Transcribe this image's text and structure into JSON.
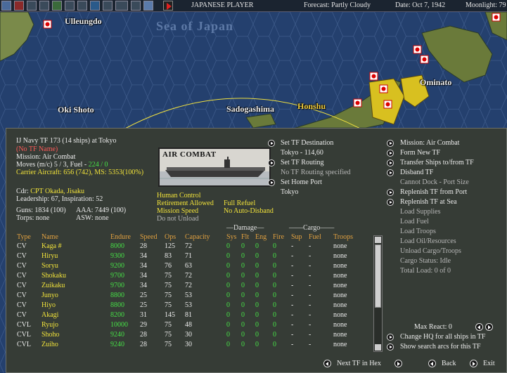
{
  "topbar": {
    "player": "JAPANESE PLAYER",
    "forecast": "Forecast: Partly Cloudy",
    "date": "Date: Oct 7, 1942",
    "moonlight": "Moonlight: 79"
  },
  "map": {
    "sea_label": "Sea of Japan",
    "places": [
      "Ulleungdo",
      "Oki Shoto",
      "Sadogashima",
      "Honshu",
      "Ominato"
    ]
  },
  "tf": {
    "header": "IJ Navy TF 173 (14 ships) at Tokyo",
    "name": "(No TF Name)",
    "mission": "Mission: Air Combat",
    "moves_prefix": "Moves (m/c)  5 / 3, Fuel - ",
    "moves_fuel": "224 / 0",
    "carrier_aircraft": "Carrier Aircraft: 656 (742), MS: 5353(100%)",
    "cdr_label": "Cdr: ",
    "cdr_name": "CPT Okada, Jisaku",
    "leadership": "Leadership: 67, Inspiration: 52",
    "guns": "Guns: 1834 (100)",
    "aaa": "AAA: 7449 (100)",
    "torps": "Torps: none",
    "asw": "ASW: none"
  },
  "photo": {
    "title": "AIR COMBAT"
  },
  "orders": {
    "human_control": "Human Control",
    "retirement": "Retirement Allowed",
    "mission_speed": "Mission Speed",
    "do_not_unload": "Do not Unload",
    "full_refuel": "Full Refuel",
    "no_auto_disband": "No Auto-Disband"
  },
  "middle": {
    "set_destination": "Set TF Destination",
    "destination_value": "Tokyo - 114,60",
    "set_routing": "Set TF Routing",
    "routing_value": "No TF Routing specified",
    "set_home_port": "Set Home Port",
    "home_port_value": "Tokyo"
  },
  "right": {
    "mission": "Mission: Air Combat",
    "form_new": "Form New TF",
    "transfer": "Transfer Ships to/from TF",
    "disband": "Disband TF",
    "cannot_dock": "Cannot Dock - Port Size",
    "replenish_port": "Replenish TF from Port",
    "replenish_sea": "Replenish TF at Sea",
    "load_supplies": "Load Supplies",
    "load_fuel": "Load Fuel",
    "load_troops": "Load Troops",
    "load_oil": "Load Oil/Resources",
    "unload": "Unload Cargo/Troops",
    "cargo_status": "Cargo Status: Idle",
    "total_load": "Total Load: 0 of 0",
    "max_react": "Max React: 0",
    "change_hq": "Change HQ for all ships in TF",
    "show_search": "Show search arcs for this TF"
  },
  "table": {
    "damage_group": "Damage",
    "cargo_group": "Cargo",
    "headers": [
      "Type",
      "Name",
      "Endure",
      "Speed",
      "Ops",
      "Capacity",
      "Sys",
      "Flt",
      "Eng",
      "Fire",
      "Sup",
      "Fuel",
      "Troops"
    ],
    "rows": [
      {
        "type": "CV",
        "name": "Kaga #",
        "endure": "8000",
        "speed": "28",
        "ops": "125",
        "cap": "72",
        "sys": "0",
        "flt": "0",
        "eng": "0",
        "fire": "0",
        "sup": "-",
        "fuel": "-",
        "troops": "none"
      },
      {
        "type": "CV",
        "name": "Hiryu",
        "endure": "9300",
        "speed": "34",
        "ops": "83",
        "cap": "71",
        "sys": "0",
        "flt": "0",
        "eng": "0",
        "fire": "0",
        "sup": "-",
        "fuel": "-",
        "troops": "none"
      },
      {
        "type": "CV",
        "name": "Soryu",
        "endure": "9200",
        "speed": "34",
        "ops": "76",
        "cap": "63",
        "sys": "0",
        "flt": "0",
        "eng": "0",
        "fire": "0",
        "sup": "-",
        "fuel": "-",
        "troops": "none"
      },
      {
        "type": "CV",
        "name": "Shokaku",
        "endure": "9700",
        "speed": "34",
        "ops": "75",
        "cap": "72",
        "sys": "0",
        "flt": "0",
        "eng": "0",
        "fire": "0",
        "sup": "-",
        "fuel": "-",
        "troops": "none"
      },
      {
        "type": "CV",
        "name": "Zuikaku",
        "endure": "9700",
        "speed": "34",
        "ops": "75",
        "cap": "72",
        "sys": "0",
        "flt": "0",
        "eng": "0",
        "fire": "0",
        "sup": "-",
        "fuel": "-",
        "troops": "none"
      },
      {
        "type": "CV",
        "name": "Junyo",
        "endure": "8800",
        "speed": "25",
        "ops": "75",
        "cap": "53",
        "sys": "0",
        "flt": "0",
        "eng": "0",
        "fire": "0",
        "sup": "-",
        "fuel": "-",
        "troops": "none"
      },
      {
        "type": "CV",
        "name": "Hiyo",
        "endure": "8800",
        "speed": "25",
        "ops": "75",
        "cap": "53",
        "sys": "0",
        "flt": "0",
        "eng": "0",
        "fire": "0",
        "sup": "-",
        "fuel": "-",
        "troops": "none"
      },
      {
        "type": "CV",
        "name": "Akagi",
        "endure": "8200",
        "speed": "31",
        "ops": "145",
        "cap": "81",
        "sys": "0",
        "flt": "0",
        "eng": "0",
        "fire": "0",
        "sup": "-",
        "fuel": "-",
        "troops": "none"
      },
      {
        "type": "CVL",
        "name": "Ryujo",
        "endure": "10000",
        "speed": "29",
        "ops": "75",
        "cap": "48",
        "sys": "0",
        "flt": "0",
        "eng": "0",
        "fire": "0",
        "sup": "-",
        "fuel": "-",
        "troops": "none"
      },
      {
        "type": "CVL",
        "name": "Shoho",
        "endure": "9240",
        "speed": "28",
        "ops": "75",
        "cap": "30",
        "sys": "0",
        "flt": "0",
        "eng": "0",
        "fire": "0",
        "sup": "-",
        "fuel": "-",
        "troops": "none"
      },
      {
        "type": "CVL",
        "name": "Zuiho",
        "endure": "9240",
        "speed": "28",
        "ops": "75",
        "cap": "30",
        "sys": "0",
        "flt": "0",
        "eng": "0",
        "fire": "0",
        "sup": "-",
        "fuel": "-",
        "troops": "none"
      }
    ]
  },
  "footer": {
    "next_tf": "Next TF in Hex",
    "back": "Back",
    "exit": "Exit"
  },
  "colors": {
    "dialog_bg": "#363c36",
    "endure_green": "#46e046",
    "name_yellow": "#f2e33a",
    "header_orange": "#e0a040",
    "warning_red": "#ff5a5a"
  }
}
